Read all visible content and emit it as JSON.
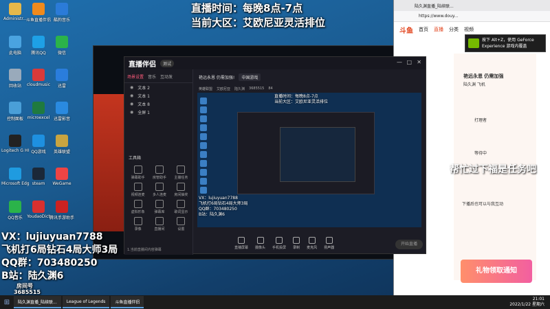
{
  "desktop_icons": [
    {
      "label": "Administr...",
      "icon": "user-folder-icon",
      "color": "#e6b84a"
    },
    {
      "label": "斗鱼直播伴侣",
      "icon": "douyu-icon",
      "color": "#f08a1c"
    },
    {
      "label": "酷狗音乐",
      "icon": "kugou-icon",
      "color": "#2b7bd8"
    },
    {
      "label": "此电脑",
      "icon": "computer-icon",
      "color": "#4aa3e0"
    },
    {
      "label": "腾讯QQ",
      "icon": "qq-icon",
      "color": "#1ea0e6"
    },
    {
      "label": "微信",
      "icon": "wechat-icon",
      "color": "#2bb34a"
    },
    {
      "label": "回收站",
      "icon": "recycle-bin-icon",
      "color": "#9ab"
    },
    {
      "label": "cloudmusic",
      "icon": "cloudmusic-icon",
      "color": "#d93a3a"
    },
    {
      "label": "迅雷",
      "icon": "xunlei-icon",
      "color": "#2a7ddc"
    },
    {
      "label": "控制面板",
      "icon": "control-panel-icon",
      "color": "#4a9fd8"
    },
    {
      "label": "microexcel",
      "icon": "excel-icon",
      "color": "#1f7a3f"
    },
    {
      "label": "迅雷影音",
      "icon": "video-icon",
      "color": "#2a8ae0"
    },
    {
      "label": "Logitech G HUB",
      "icon": "logitech-icon",
      "color": "#222"
    },
    {
      "label": "QQ游戏",
      "icon": "qq-game-icon",
      "color": "#1e90e0"
    },
    {
      "label": "英雄联盟",
      "icon": "lol-icon",
      "color": "#c8a440"
    },
    {
      "label": "Microsoft Edge",
      "icon": "edge-icon",
      "color": "#1f9be0"
    },
    {
      "label": "steam",
      "icon": "steam-icon",
      "color": "#1b2838"
    },
    {
      "label": "WeGame",
      "icon": "wegame-icon",
      "color": "#e44"
    },
    {
      "label": "QQ音乐",
      "icon": "qq-music-icon",
      "color": "#2bb34a"
    },
    {
      "label": "YoudaoDict",
      "icon": "youdao-icon",
      "color": "#d8302f"
    },
    {
      "label": "腾讯手游助手",
      "icon": "tencent-icon",
      "color": "#c22"
    }
  ],
  "overlay": {
    "top_line1": "直播时间：每晚8点-7点",
    "top_line2": "当前大区：艾欧尼亚灵活排位",
    "bottom_line1": "VX：lujiuyuan7788",
    "bottom_line2": "飞机打6局钻石4局大师3局",
    "bottom_line3": "QQ群：703480250",
    "bottom_line4": "B站：陆久渊6",
    "room_label": "房间号",
    "room_number": "3685515",
    "help_text": "帮忙过下福是任务吧"
  },
  "browser": {
    "tab_title": "陆久渊直播_陆续联...",
    "url": "https://www.douy...",
    "nav": [
      "首页",
      "直播",
      "分类",
      "视频"
    ],
    "nav_active": "直播",
    "logo": "斗鱼"
  },
  "geforce": {
    "line1": "按下 Alt+Z，使用 GeForce",
    "line2": "Experience 游戏内覆盖"
  },
  "side_panel": {
    "title": "艳远永恩 仍需加强",
    "sub": "陆久渊 飞机",
    "texts": [
      "打理者",
      "等待中",
      "下播后也可以与我互动"
    ],
    "banner": "礼物领取通知"
  },
  "app": {
    "brand": "直播伴侣",
    "version": "测试",
    "tabs": [
      "场景设置",
      "音乐",
      "互动发"
    ],
    "tab_active": "场景设置",
    "scenes": [
      "文本 2",
      "文本 1",
      "文本 8",
      "全屏 1"
    ],
    "tools_title": "工具箱",
    "tools": [
      "弹幕助手",
      "房管助手",
      "主播任务",
      "视频连麦",
      "多人连麦",
      "房间抽奖",
      "虚拟形象",
      "弹幕库",
      "歌词显示",
      "录像",
      "直播间",
      "设置"
    ],
    "footer": "1.当前直播间内容弹幕",
    "header_title": "艳远永恩 仍需加强!",
    "header_badge": "中国游戏",
    "sub_items": [
      "英雄联盟",
      "艾欧尼亚",
      "陆久渊",
      "3685515"
    ],
    "sub_count": "84",
    "bottom_buttons": [
      "直播屏幕",
      "摄像头",
      "手机投屏",
      "录制",
      "麦克风",
      "扬声器"
    ],
    "go_live": "开始直播",
    "preview_texts": [
      "直播时间：每晚8点-7点",
      "当前大区：艾欧尼亚灵活排位",
      "VX：lujiuyuan7788",
      "飞机打6局钻石4局大师3局",
      "QQ群：703480250",
      "B站：陆久渊6"
    ]
  },
  "taskbar": {
    "items": [
      "陆久渊直播_陆续联...",
      "League of Legends",
      "斗鱼直播伴侣"
    ],
    "time": "21:01",
    "date": "2022/1/22 星期六"
  }
}
